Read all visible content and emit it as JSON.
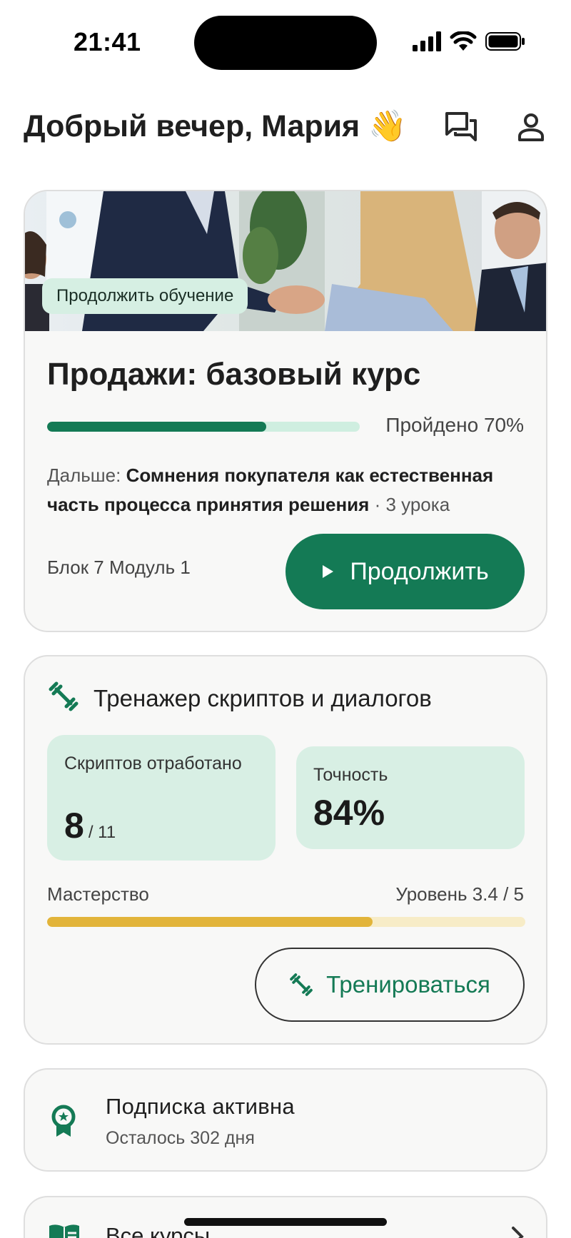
{
  "status_bar": {
    "time": "21:41",
    "icons": [
      "cellular-signal-icon",
      "wifi-icon",
      "battery-icon"
    ]
  },
  "header": {
    "greeting": "Добрый вечер, Мария 👋",
    "icons": [
      "chat-icon",
      "profile-icon"
    ]
  },
  "course_card": {
    "chip": "Продолжить обучение",
    "title": "Продажи: базовый курс",
    "progress": 0.7,
    "progress_label": "Пройдено 70%",
    "next_prefix": "Дальше: ",
    "next_lesson": "Сомнения покупателя как естественная часть процесса принятия решения",
    "next_lessons_count": " · 3 урока",
    "position_label": "Блок 7 Модуль 1",
    "continue_label": "Продолжить",
    "accent_color": "#147a55"
  },
  "trainer_card": {
    "title": "Тренажер скриптов и диалогов",
    "scripts_label": "Скриптов отработано",
    "scripts_value": "8",
    "scripts_total": "/ 11",
    "accuracy_label": "Точность",
    "accuracy_value": "84%",
    "mastery_label": "Мастерство",
    "level_label": "Уровень 3.4 / 5",
    "mastery_level": 3.4,
    "mastery_max": 5,
    "mastery_color": "#e2b43a",
    "train_label": "Тренироваться"
  },
  "subscription_card": {
    "title": "Подписка активна",
    "days_left": "Осталось 302 дня",
    "icon": "award-badge-icon"
  },
  "all_courses_card": {
    "label": "Все курсы",
    "icon": "book-icon"
  }
}
